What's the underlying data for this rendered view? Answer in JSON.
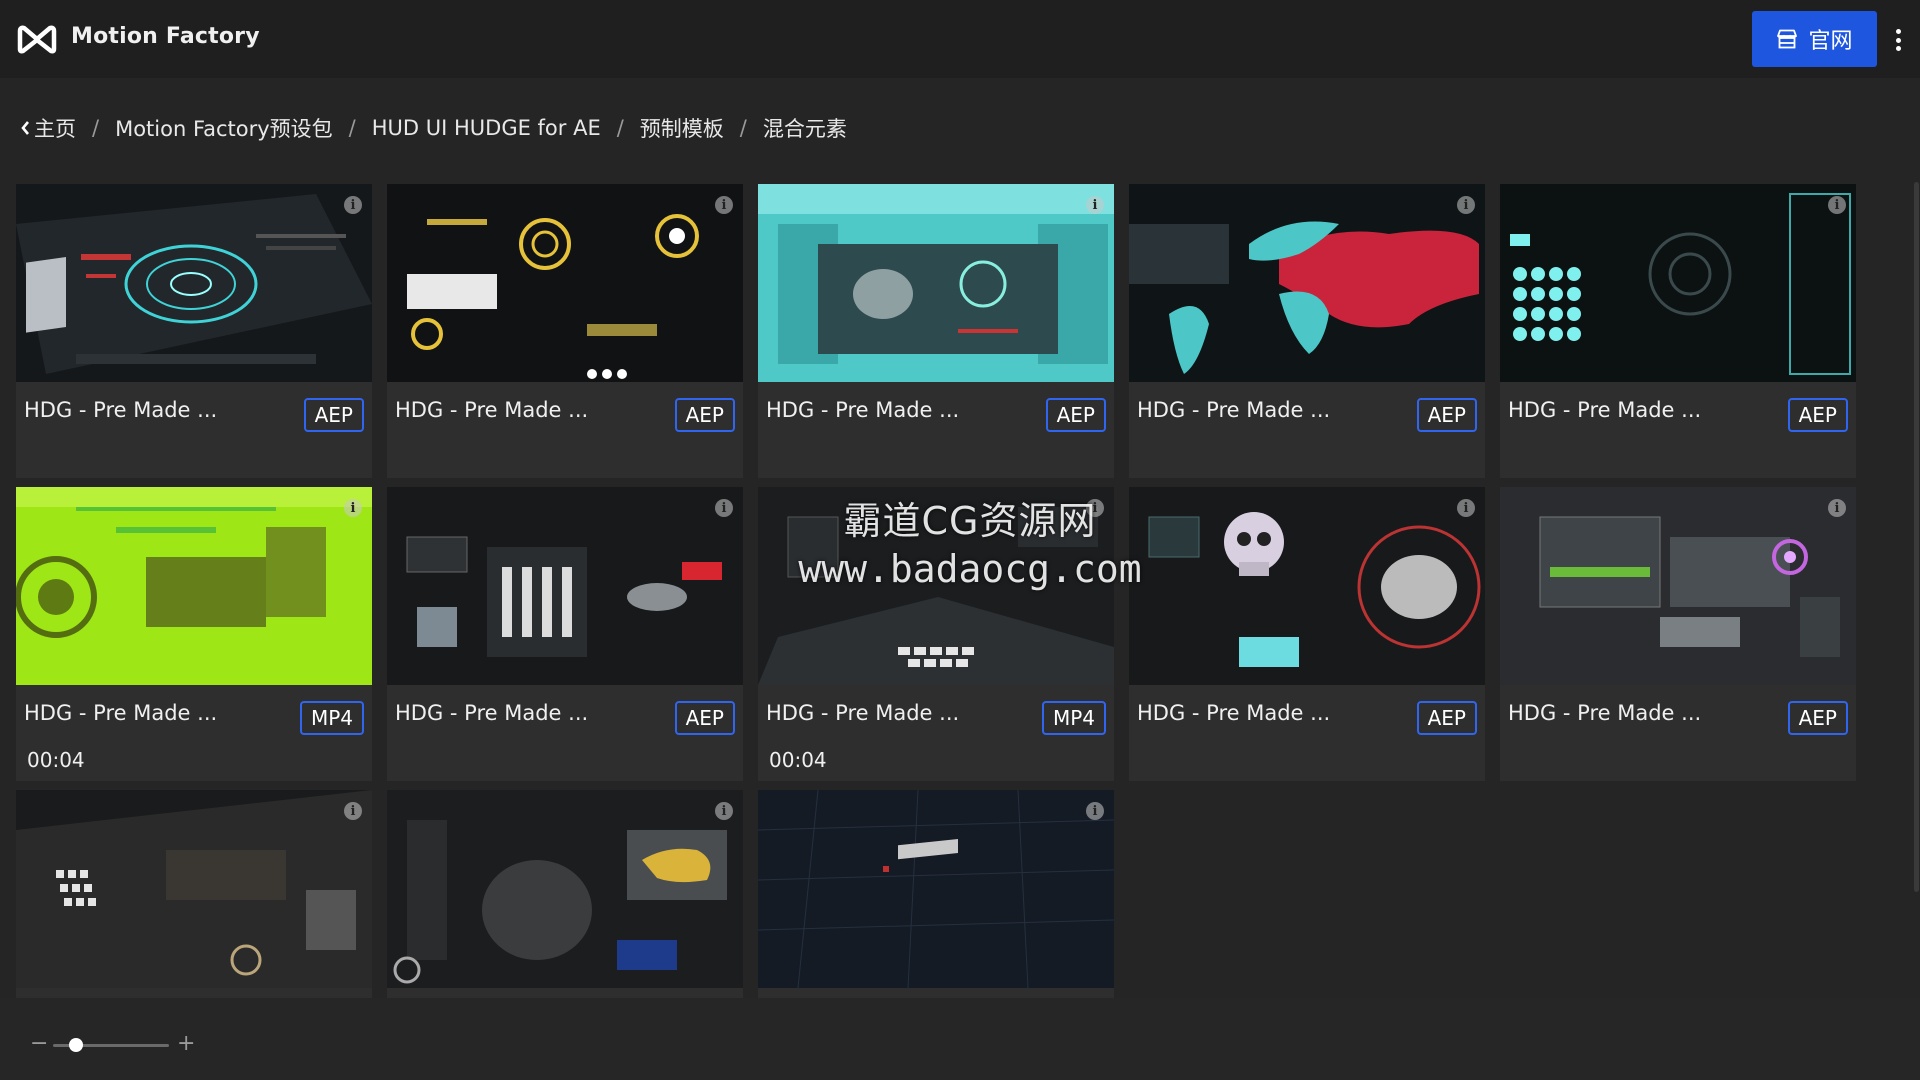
{
  "header": {
    "app_title": "Motion Factory",
    "website_button": "官网",
    "accent_color": "#1f56e0"
  },
  "breadcrumb": {
    "items": [
      "主页",
      "Motion Factory预设包",
      "HUD UI HUDGE for AE",
      "预制模板",
      "混合元素"
    ],
    "separator": "/"
  },
  "cards": [
    {
      "title": "HDG - Pre Made ...",
      "badge": "AEP",
      "duration": ""
    },
    {
      "title": "HDG - Pre Made ...",
      "badge": "AEP",
      "duration": ""
    },
    {
      "title": "HDG - Pre Made ...",
      "badge": "AEP",
      "duration": ""
    },
    {
      "title": "HDG - Pre Made ...",
      "badge": "AEP",
      "duration": ""
    },
    {
      "title": "HDG - Pre Made ...",
      "badge": "AEP",
      "duration": ""
    },
    {
      "title": "HDG - Pre Made ...",
      "badge": "MP4",
      "duration": "00:04"
    },
    {
      "title": "HDG - Pre Made ...",
      "badge": "AEP",
      "duration": ""
    },
    {
      "title": "HDG - Pre Made ...",
      "badge": "MP4",
      "duration": "00:04"
    },
    {
      "title": "HDG - Pre Made ...",
      "badge": "AEP",
      "duration": ""
    },
    {
      "title": "HDG - Pre Made ...",
      "badge": "AEP",
      "duration": ""
    }
  ],
  "watermark": {
    "line1": "霸道CG资源网",
    "line2": "www.badaocg.com"
  },
  "footer": {
    "zoom_minus": "−",
    "zoom_plus": "+",
    "zoom_level": 0.2
  }
}
